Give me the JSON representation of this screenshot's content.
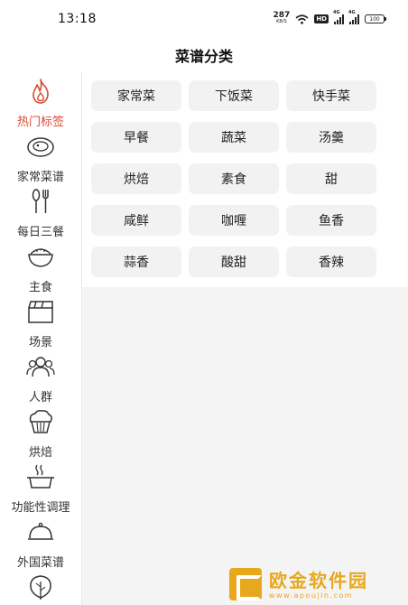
{
  "status_bar": {
    "time": "13:18",
    "net_speed": "287",
    "net_unit": "KB/S",
    "hd": "HD",
    "signal_1": "4G",
    "signal_2": "4G",
    "battery": "100"
  },
  "header": {
    "title": "菜谱分类"
  },
  "sidebar": {
    "active_index": 0,
    "items": [
      {
        "label": "热门标签",
        "icon": "flame-icon"
      },
      {
        "label": "家常菜谱",
        "icon": "dish-plate-icon"
      },
      {
        "label": "每日三餐",
        "icon": "spoon-fork-icon"
      },
      {
        "label": "主食",
        "icon": "rice-bowl-icon"
      },
      {
        "label": "场景",
        "icon": "clapperboard-icon"
      },
      {
        "label": "人群",
        "icon": "people-icon"
      },
      {
        "label": "烘焙",
        "icon": "muffin-icon"
      },
      {
        "label": "功能性调理",
        "icon": "steaming-pot-icon"
      },
      {
        "label": "外国菜谱",
        "icon": "cloche-icon"
      },
      {
        "label": "",
        "icon": "leaf-icon"
      }
    ]
  },
  "tags": [
    "家常菜",
    "下饭菜",
    "快手菜",
    "早餐",
    "蔬菜",
    "汤羹",
    "烘焙",
    "素食",
    "甜",
    "咸鲜",
    "咖喱",
    "鱼香",
    "蒜香",
    "酸甜",
    "香辣"
  ],
  "watermark": {
    "name": "欧金软件园",
    "url": "www.apoujin.com"
  },
  "colors": {
    "accent": "#d84a32",
    "tag_bg": "#f2f2f2",
    "content_bg": "#f4f4f4",
    "watermark": "#e8a81d"
  }
}
